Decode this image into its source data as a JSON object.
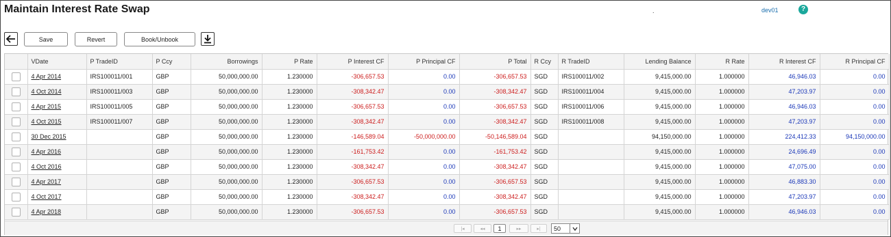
{
  "page": {
    "title": "Maintain Interest Rate Swap",
    "dot": ".",
    "user": "dev01",
    "help_icon": "question-icon",
    "help_glyph": "?"
  },
  "toolbar": {
    "back_icon": "arrow-left-icon",
    "save_label": "Save",
    "revert_label": "Revert",
    "book_label": "Book/Unbook",
    "download_icon": "download-icon"
  },
  "grid": {
    "columns": [
      "",
      "VDate",
      "P TradeID",
      "P Ccy",
      "Borrowings",
      "P Rate",
      "P Interest CF",
      "P Principal CF",
      "P Total",
      "R Ccy",
      "R TradeID",
      "Lending Balance",
      "R Rate",
      "R Interest CF",
      "R Principal CF"
    ],
    "rows": [
      [
        "4 Apr 2014",
        "IRS100011/001",
        "GBP",
        "50,000,000.00",
        "1.230000",
        "-306,657.53",
        "0.00",
        "-306,657.53",
        "SGD",
        "IRS100011/002",
        "9,415,000.00",
        "1.000000",
        "46,946.03",
        "0.00"
      ],
      [
        "4 Oct 2014",
        "IRS100011/003",
        "GBP",
        "50,000,000.00",
        "1.230000",
        "-308,342.47",
        "0.00",
        "-308,342.47",
        "SGD",
        "IRS100011/004",
        "9,415,000.00",
        "1.000000",
        "47,203.97",
        "0.00"
      ],
      [
        "4 Apr 2015",
        "IRS100011/005",
        "GBP",
        "50,000,000.00",
        "1.230000",
        "-306,657.53",
        "0.00",
        "-306,657.53",
        "SGD",
        "IRS100011/006",
        "9,415,000.00",
        "1.000000",
        "46,946.03",
        "0.00"
      ],
      [
        "4 Oct 2015",
        "IRS100011/007",
        "GBP",
        "50,000,000.00",
        "1.230000",
        "-308,342.47",
        "0.00",
        "-308,342.47",
        "SGD",
        "IRS100011/008",
        "9,415,000.00",
        "1.000000",
        "47,203.97",
        "0.00"
      ],
      [
        "30 Dec 2015",
        "",
        "GBP",
        "50,000,000.00",
        "1.230000",
        "-146,589.04",
        "-50,000,000.00",
        "-50,146,589.04",
        "SGD",
        "",
        "94,150,000.00",
        "1.000000",
        "224,412.33",
        "94,150,000.00"
      ],
      [
        "4 Apr 2016",
        "",
        "GBP",
        "50,000,000.00",
        "1.230000",
        "-161,753.42",
        "0.00",
        "-161,753.42",
        "SGD",
        "",
        "9,415,000.00",
        "1.000000",
        "24,696.49",
        "0.00"
      ],
      [
        "4 Oct 2016",
        "",
        "GBP",
        "50,000,000.00",
        "1.230000",
        "-308,342.47",
        "0.00",
        "-308,342.47",
        "SGD",
        "",
        "9,415,000.00",
        "1.000000",
        "47,075.00",
        "0.00"
      ],
      [
        "4 Apr 2017",
        "",
        "GBP",
        "50,000,000.00",
        "1.230000",
        "-306,657.53",
        "0.00",
        "-306,657.53",
        "SGD",
        "",
        "9,415,000.00",
        "1.000000",
        "46,883.30",
        "0.00"
      ],
      [
        "4 Oct 2017",
        "",
        "GBP",
        "50,000,000.00",
        "1.230000",
        "-308,342.47",
        "0.00",
        "-308,342.47",
        "SGD",
        "",
        "9,415,000.00",
        "1.000000",
        "47,203.97",
        "0.00"
      ],
      [
        "4 Apr 2018",
        "",
        "GBP",
        "50,000,000.00",
        "1.230000",
        "-306,657.53",
        "0.00",
        "-306,657.53",
        "SGD",
        "",
        "9,415,000.00",
        "1.000000",
        "46,946.03",
        "0.00"
      ]
    ]
  },
  "pager": {
    "first": "|◂",
    "prev": "◂◂",
    "page": "1",
    "next": "▸▸",
    "last": "▸|",
    "page_size": "50"
  },
  "colors": {
    "negative": "#cc1c1c",
    "positive": "#1a37b8",
    "help": "#1ba89c",
    "user": "#1b6fae"
  }
}
